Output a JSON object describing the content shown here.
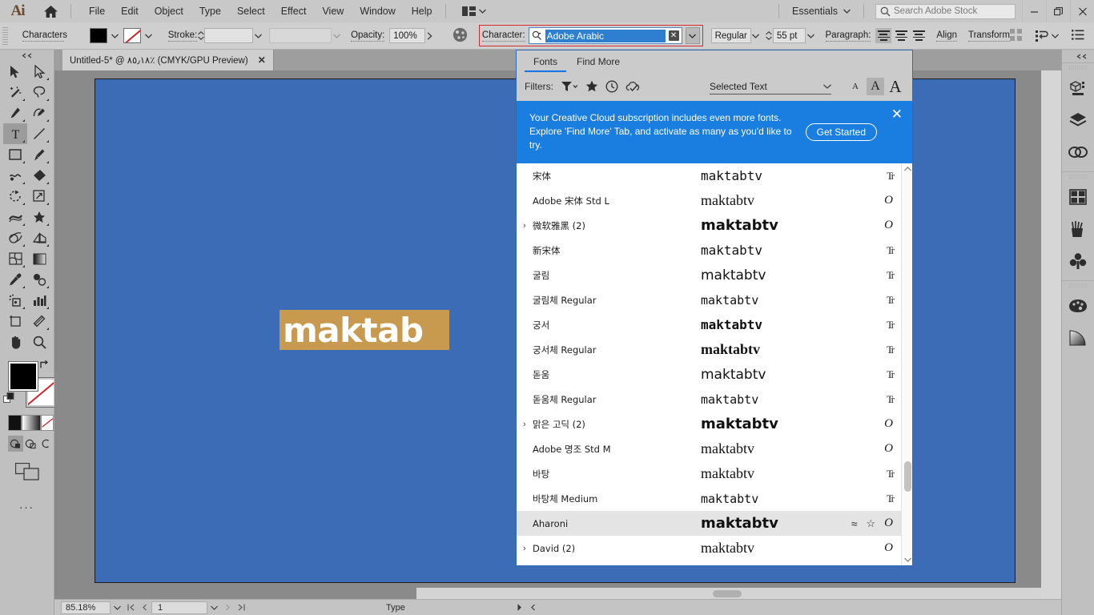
{
  "app": {
    "name": "Ai",
    "logo_label": "Ai"
  },
  "menubar": {
    "items": [
      "File",
      "Edit",
      "Object",
      "Type",
      "Select",
      "Effect",
      "View",
      "Window",
      "Help"
    ],
    "workspace": "Essentials",
    "search_placeholder": "Search Adobe Stock",
    "window_buttons": [
      "minimize",
      "restore",
      "close"
    ]
  },
  "controlbar": {
    "characters_label": "Characters",
    "stroke_label": "Stroke:",
    "stroke_weight": "",
    "stroke_profile": "",
    "opacity_label": "Opacity:",
    "opacity_value": "100%",
    "character_label": "Character:",
    "font_family_value": "Adobe Arabic",
    "font_style_value": "Regular",
    "font_size_value": "55 pt",
    "paragraph_label": "Paragraph:",
    "align_label": "Align",
    "transform_label": "Transform",
    "highlight_color": "#d7282f",
    "selection_color": "#2f7fd1"
  },
  "document": {
    "tab_title": "Untitled-5* @ ٨٥٫١٨٪ (CMYK/GPU Preview)",
    "artboard_color": "#3b6cb5",
    "text_content": "maktab",
    "text_highlight_color": "#c79a4f"
  },
  "toolbar": {
    "tools": [
      "selection-tool",
      "direct-selection-tool",
      "magic-wand-tool",
      "lasso-tool",
      "pen-tool",
      "curvature-tool",
      "type-tool",
      "line-segment-tool",
      "rectangle-tool",
      "paintbrush-tool",
      "shaper-tool",
      "eraser-tool",
      "rotate-tool",
      "scale-tool",
      "width-tool",
      "free-transform-tool",
      "shape-builder-tool",
      "perspective-grid-tool",
      "mesh-tool",
      "gradient-tool",
      "eyedropper-tool",
      "blend-tool",
      "symbol-sprayer-tool",
      "column-graph-tool",
      "artboard-tool",
      "slice-tool",
      "hand-tool",
      "zoom-tool"
    ],
    "active_tool": "type-tool",
    "fill_color": "#000000",
    "stroke_color": "none",
    "more_label": "..."
  },
  "fonts_panel": {
    "tabs": [
      {
        "label": "Fonts",
        "active": true
      },
      {
        "label": "Find More",
        "active": false
      }
    ],
    "filters_label": "Filters:",
    "filter_icons": [
      "filter-funnel-icon",
      "star-icon",
      "clock-icon",
      "cloud-check-icon"
    ],
    "scope_dropdown": "Selected Text",
    "size_buttons": [
      "A-small",
      "A-medium",
      "A-large"
    ],
    "size_active_index": 1,
    "banner": {
      "line1": "Your Creative Cloud subscription includes even more fonts.",
      "line2": "Explore 'Find More' Tab, and activate as many as you'd like to try.",
      "button": "Get Started",
      "color": "#1a7de0"
    },
    "preview_text": "maktabtv",
    "rows": [
      {
        "name": "宋体",
        "expandable": false,
        "style": "pv-song",
        "type_icon": "truetype",
        "selected": false
      },
      {
        "name": "Adobe 宋体 Std L",
        "expandable": false,
        "style": "pv-serif",
        "type_icon": "opentype",
        "selected": false
      },
      {
        "name": "微软雅黑 (2)",
        "expandable": true,
        "style": "pv-bold",
        "type_icon": "opentype",
        "selected": false
      },
      {
        "name": "新宋体",
        "expandable": false,
        "style": "pv-song",
        "type_icon": "truetype",
        "selected": false
      },
      {
        "name": "굴림",
        "expandable": false,
        "style": "pv-sans",
        "type_icon": "truetype",
        "selected": false
      },
      {
        "name": "굴림체 Regular",
        "expandable": false,
        "style": "pv-mono",
        "type_icon": "truetype",
        "selected": false
      },
      {
        "name": "궁서",
        "expandable": false,
        "style": "pv-monob",
        "type_icon": "truetype",
        "selected": false
      },
      {
        "name": "궁서체 Regular",
        "expandable": false,
        "style": "pv-serifb",
        "type_icon": "truetype",
        "selected": false
      },
      {
        "name": "돋움",
        "expandable": false,
        "style": "pv-sans",
        "type_icon": "truetype",
        "selected": false
      },
      {
        "name": "돋움체 Regular",
        "expandable": false,
        "style": "pv-mono",
        "type_icon": "truetype",
        "selected": false
      },
      {
        "name": "맑은 고딕 (2)",
        "expandable": true,
        "style": "pv-bold",
        "type_icon": "opentype",
        "selected": false
      },
      {
        "name": "Adobe 명조 Std M",
        "expandable": false,
        "style": "pv-serif",
        "type_icon": "opentype",
        "selected": false
      },
      {
        "name": "바탕",
        "expandable": false,
        "style": "pv-serif",
        "type_icon": "truetype",
        "selected": false
      },
      {
        "name": "바탕체 Medium",
        "expandable": false,
        "style": "pv-mono",
        "type_icon": "truetype",
        "selected": false
      },
      {
        "name": "Aharoni",
        "expandable": false,
        "style": "pv-bold",
        "type_icon": "opentype",
        "selected": true,
        "has_similar": true,
        "has_favorite": true
      },
      {
        "name": "David (2)",
        "expandable": true,
        "style": "pv-serif",
        "type_icon": "opentype",
        "selected": false
      }
    ]
  },
  "statusbar": {
    "zoom_value": "85.18%",
    "page_value": "1",
    "tool_indicator": "Type"
  },
  "right_dock": {
    "groups": [
      [
        "properties-icon",
        "layers-icon",
        "links-icon"
      ],
      [
        "artboards-icon",
        "brushes-icon",
        "symbols-icon"
      ],
      [
        "swatches-icon",
        "gradient-icon"
      ]
    ]
  }
}
